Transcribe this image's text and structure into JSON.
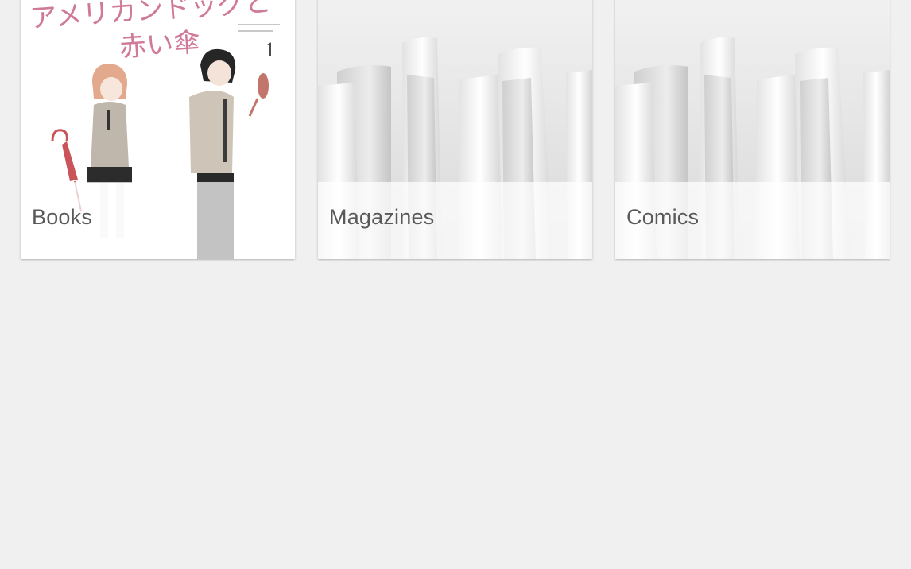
{
  "categories": [
    {
      "label": "Books",
      "cover": {
        "title_line1": "アメリカンドッグと",
        "title_line2": "赤い傘",
        "volume": "1"
      }
    },
    {
      "label": "Magazines"
    },
    {
      "label": "Comics"
    }
  ],
  "colors": {
    "background": "#f0f0f0",
    "tile": "#ffffff",
    "label_text": "#595959",
    "cover_title": "#d07a9a"
  }
}
